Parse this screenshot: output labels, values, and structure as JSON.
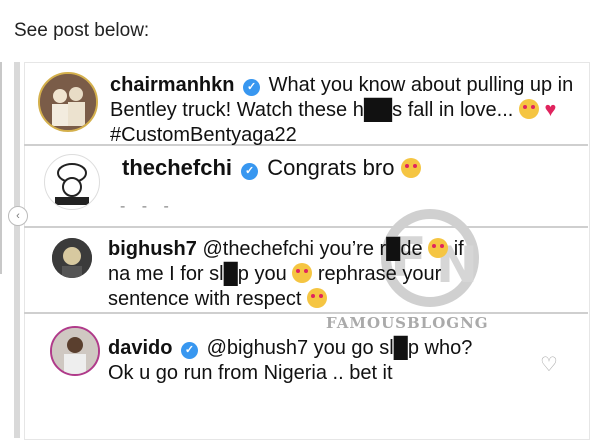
{
  "header": {
    "text": "See post below:"
  },
  "comments": [
    {
      "username": "chairmanhkn",
      "verified": true,
      "line1": "What you know about pulling up in",
      "line2": "Bentley truck! Watch these h██s fall in love...",
      "line3": "#CustomBentyaga22"
    },
    {
      "username": "thechefchi",
      "verified": true,
      "text": "Congrats bro"
    },
    {
      "username": "bighush7",
      "verified": false,
      "line1": "@thechefchi you’re r█de",
      "line1b": "if",
      "line2a": "na me I for sl█p you",
      "line2b": "rephrase your",
      "line3": "sentence with respect"
    },
    {
      "username": "davido",
      "verified": true,
      "line1": "@bighush7 you go sl█p who?",
      "line2": "Ok u go run from Nigeria .. bet it"
    }
  ],
  "more_dots": "- - -",
  "watermark": "FAMOUSBLOGNG",
  "icons": {
    "verified": "verified-badge-icon",
    "heart": "heart-outline-icon",
    "emoji": "heart-eyes-emoji-icon"
  },
  "colors": {
    "verified": "#3897f0",
    "heart": "#e0245e",
    "emoji": "#f5c542"
  }
}
